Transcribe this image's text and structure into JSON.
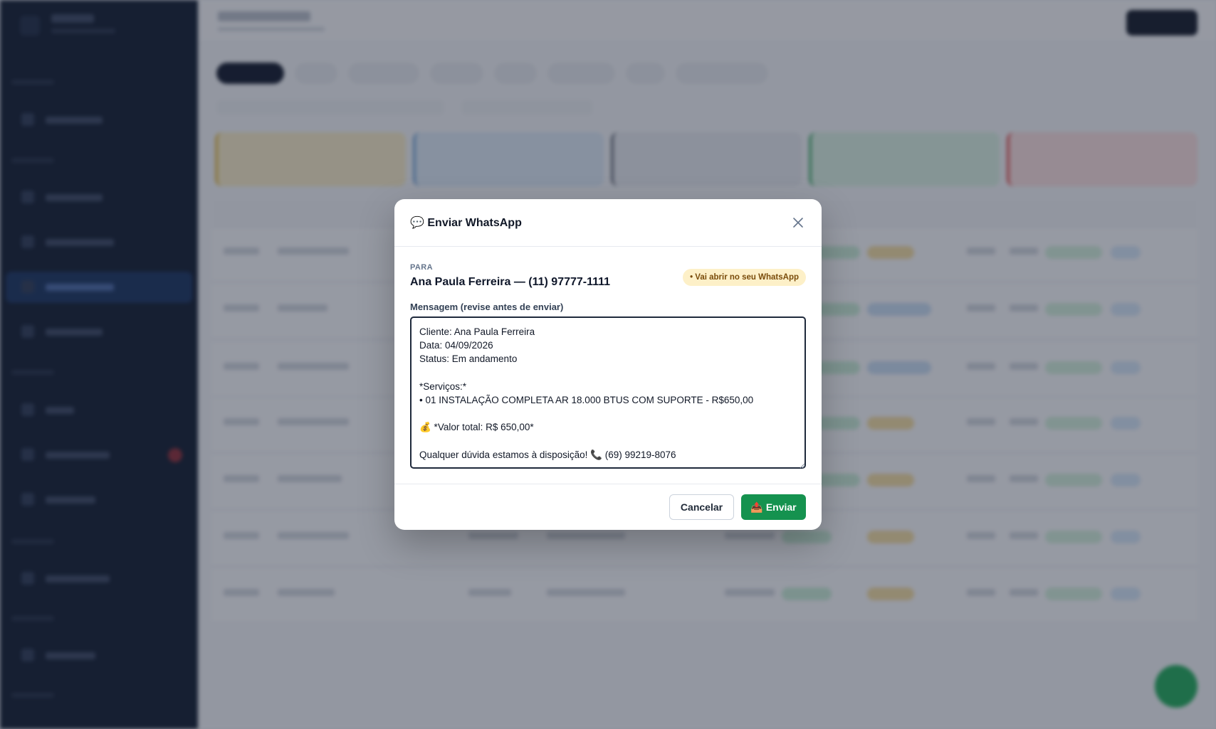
{
  "modal": {
    "title_icon": "speech-balloon-icon",
    "title_icon_glyph": "💬",
    "title": "Enviar WhatsApp",
    "to_label": "PARA",
    "to_value": "Ana Paula Ferreira — (11) 97777-1111",
    "badge": "• Vai abrir no seu WhatsApp",
    "message_label": "Mensagem (revise antes de enviar)",
    "message": "Cliente: Ana Paula Ferreira\nData: 04/09/2026\nStatus: Em andamento\n\n*Serviços:*\n• 01 INSTALAÇÃO COMPLETA AR 18.000 BTUS COM SUPORTE - R$650,00\n\n💰 *Valor total: R$ 650,00*\n\nQualquer dúvida estamos à disposição! 📞 (69) 99219-8076",
    "cancel_label": "Cancelar",
    "send_icon_glyph": "📤",
    "send_label": "Enviar"
  },
  "colors": {
    "send_button": "#15924f",
    "badge_bg": "#fdf0c8",
    "badge_text": "#7a4c0b",
    "sidebar_bg": "#0f1a2e",
    "overlay": "rgba(30,38,55,0.45)"
  }
}
